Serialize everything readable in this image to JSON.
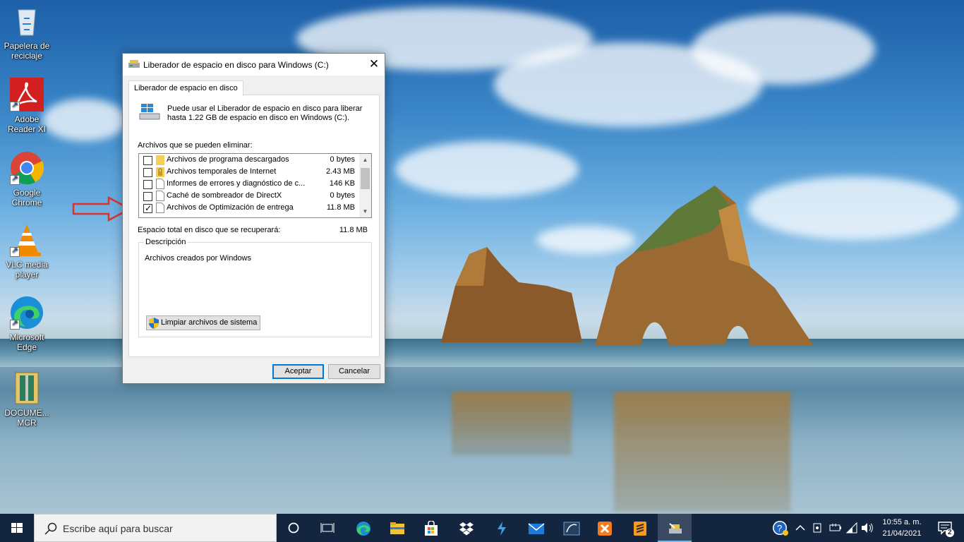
{
  "desktop_icons": [
    {
      "label": "Papelera de reciclaje",
      "icon": "recycle-bin-icon"
    },
    {
      "label": "Adobe Reader XI",
      "icon": "adobe-reader-icon"
    },
    {
      "label": "Google Chrome",
      "icon": "chrome-icon"
    },
    {
      "label": "VLC media player",
      "icon": "vlc-icon"
    },
    {
      "label": "Microsoft Edge",
      "icon": "edge-icon"
    },
    {
      "label": "DOCUME... MCR",
      "icon": "archive-icon"
    }
  ],
  "dialog": {
    "title": "Liberador de espacio en disco para Windows (C:)",
    "close": "✕",
    "tab": "Liberador de espacio en disco",
    "intro": "Puede usar el Liberador de espacio en disco para liberar hasta 1.22 GB de espacio en disco en Windows (C:).",
    "files_label": "Archivos que se pueden eliminar:",
    "files": [
      {
        "name": "Archivos de programa descargados",
        "size": "0 bytes",
        "checked": false,
        "icon": "folder-icon"
      },
      {
        "name": "Archivos temporales de Internet",
        "size": "2.43 MB",
        "checked": false,
        "icon": "lock-folder-icon"
      },
      {
        "name": "Informes de errores y diagnóstico de c...",
        "size": "146 KB",
        "checked": false,
        "icon": "document-icon"
      },
      {
        "name": "Caché de sombreador de DirectX",
        "size": "0 bytes",
        "checked": false,
        "icon": "document-icon"
      },
      {
        "name": "Archivos de Optimización de entrega",
        "size": "11.8 MB",
        "checked": true,
        "icon": "document-icon"
      }
    ],
    "total_label": "Espacio total en disco que se recuperará:",
    "total_value": "11.8 MB",
    "description_legend": "Descripción",
    "description_text": "Archivos creados por Windows",
    "clean_system_button": "Limpiar archivos de sistema",
    "ok_button": "Aceptar",
    "cancel_button": "Cancelar"
  },
  "taskbar": {
    "search_placeholder": "Escribe aquí para buscar",
    "time": "10:55 a. m.",
    "date": "21/04/2021",
    "notification_count": "2"
  },
  "colors": {
    "accent": "#0078d7",
    "taskbar": "#14253f",
    "arrow": "#e0302a"
  }
}
